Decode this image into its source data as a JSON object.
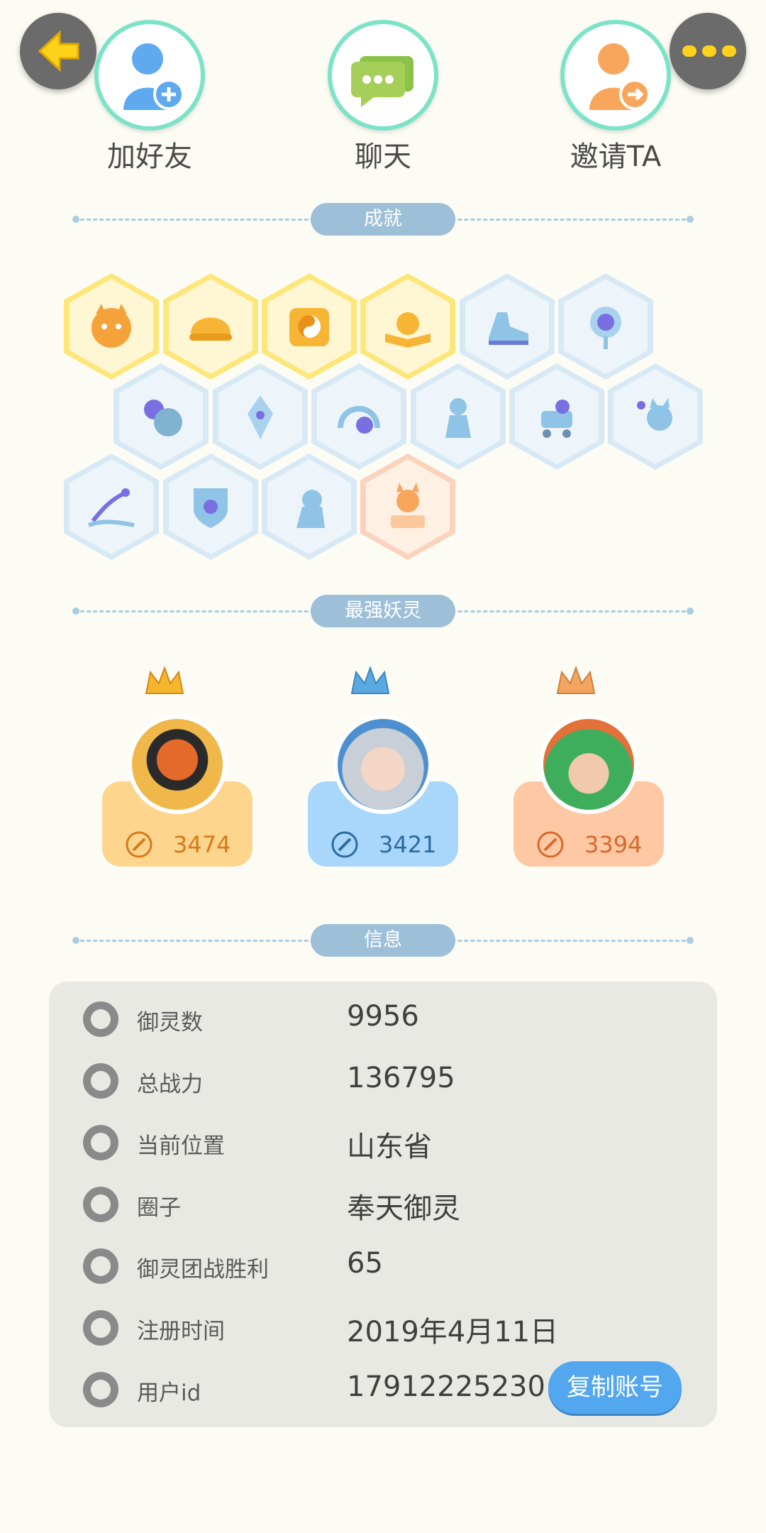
{
  "top_actions": {
    "add_friend": "加好友",
    "chat": "聊天",
    "invite": "邀请TA"
  },
  "sections": {
    "achievements": "成就",
    "strongest": "最强妖灵",
    "info": "信息"
  },
  "strongest": [
    {
      "power": "3474"
    },
    {
      "power": "3421"
    },
    {
      "power": "3394"
    }
  ],
  "info": {
    "rows": [
      {
        "label": "御灵数",
        "value": "9956"
      },
      {
        "label": "总战力",
        "value": "136795"
      },
      {
        "label": "当前位置",
        "value": "山东省"
      },
      {
        "label": "圈子",
        "value": "奉天御灵"
      },
      {
        "label": "御灵团战胜利",
        "value": "65"
      },
      {
        "label": "注册时间",
        "value": "2019年4月11日"
      },
      {
        "label": "用户id",
        "value": "17912225230"
      }
    ],
    "copy_button": "复制账号"
  },
  "colors": {
    "background": "#fcfcf4",
    "divider_pill": "#9dbfd8",
    "gold_badge": "#fde77a",
    "blue_badge": "#d7e9f5",
    "copy_button": "#53a7ee",
    "action_ring": "#7be3c8"
  }
}
